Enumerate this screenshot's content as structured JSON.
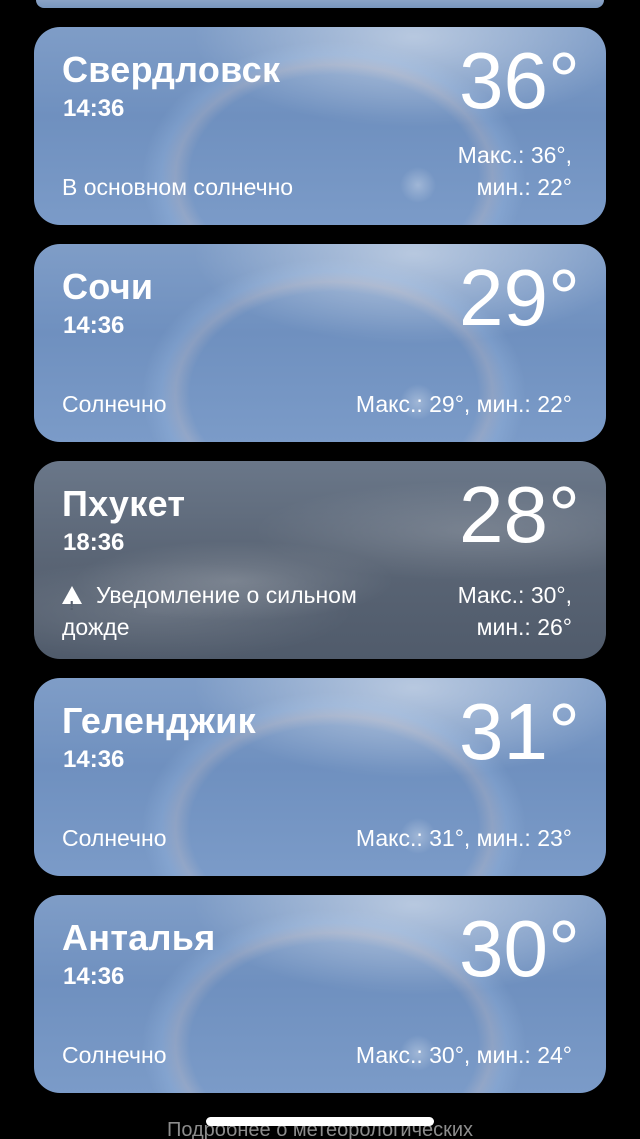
{
  "cards": [
    {
      "city": "Свердловск",
      "time": "14:36",
      "temp": "36°",
      "condition": "В основном солнечно",
      "hilo_line1": "Макс.: 36°,",
      "hilo_line2": "мин.: 22°"
    },
    {
      "city": "Сочи",
      "time": "14:36",
      "temp": "29°",
      "condition": "Солнечно",
      "hilo": "Макс.: 29°, мин.: 22°"
    },
    {
      "city": "Пхукет",
      "time": "18:36",
      "temp": "28°",
      "alert": "Уведомление о сильном дожде",
      "hilo_line1": "Макс.: 30°,",
      "hilo_line2": "мин.: 26°"
    },
    {
      "city": "Геленджик",
      "time": "14:36",
      "temp": "31°",
      "condition": "Солнечно",
      "hilo": "Макс.: 31°, мин.: 23°"
    },
    {
      "city": "Анталья",
      "time": "14:36",
      "temp": "30°",
      "condition": "Солнечно",
      "hilo": "Макс.: 30°, мин.: 24°"
    }
  ],
  "footer": {
    "text": "Подробнее о метеорологических"
  },
  "colors": {
    "background": "#000000",
    "sunny_card": "#7596c3",
    "cloudy_card": "#5b6676"
  }
}
